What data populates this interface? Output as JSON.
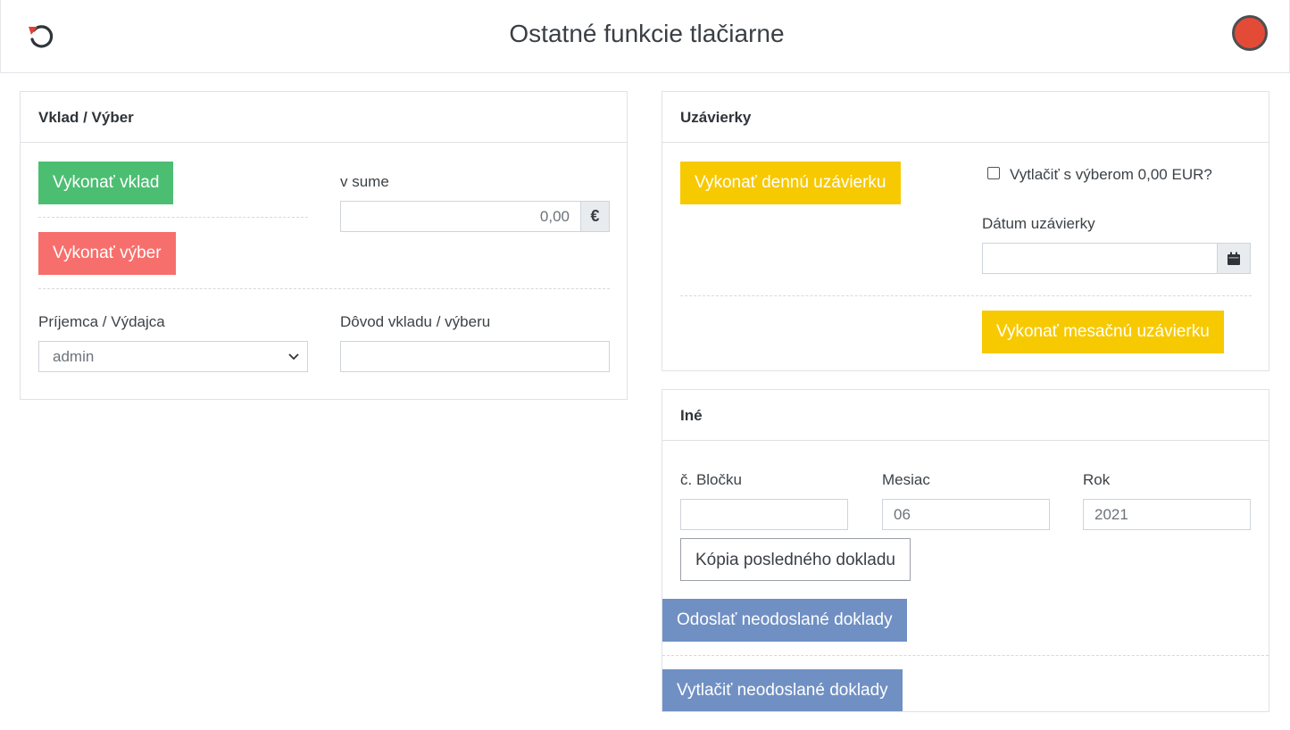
{
  "header": {
    "title": "Ostatné funkcie tlačiarne",
    "status_color": "#e34b36"
  },
  "deposit_card": {
    "title": "Vklad / Výber",
    "deposit_button": "Vykonať vklad",
    "withdraw_button": "Vykonať výber",
    "amount_label": "v sume",
    "amount_value": "0,00",
    "currency_symbol": "€",
    "recipient_label": "Príjemca / Výdajca",
    "recipient_selected": "admin",
    "reason_label": "Dôvod vkladu / výberu",
    "reason_value": ""
  },
  "closures_card": {
    "title": "Uzávierky",
    "daily_button": "Vykonať dennú uzávierku",
    "print_with_withdrawal_label": "Vytlačiť s výberom 0,00 EUR?",
    "print_with_withdrawal_checked": false,
    "date_label": "Dátum uzávierky",
    "date_value": "",
    "monthly_button": "Vykonať mesačnú uzávierku"
  },
  "other_card": {
    "title": "Iné",
    "receipt_no_label": "č. Bločku",
    "receipt_no_value": "",
    "month_label": "Mesiac",
    "month_value": "06",
    "year_label": "Rok",
    "year_value": "2021",
    "copy_last_button": "Kópia posledného dokladu",
    "send_unsent_button": "Odoslať neodoslané doklady",
    "print_unsent_button": "Vytlačiť neodoslané doklady"
  },
  "colors": {
    "green": "#4cbe72",
    "red": "#f76f6c",
    "yellow": "#f7c900",
    "blue": "#7090c4"
  }
}
